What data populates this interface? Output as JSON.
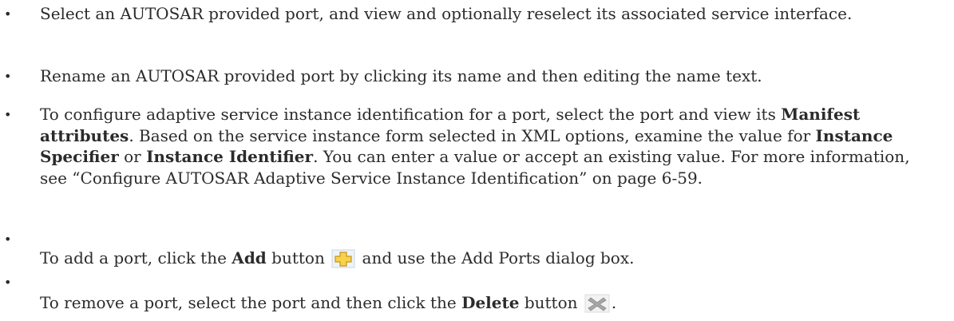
{
  "bullets": [
    {
      "symbol": "•",
      "text": "Select an AUTOSAR provided port, and view and optionally reselect its associated service interface."
    },
    {
      "symbol": "•",
      "text": "Rename an AUTOSAR provided port by clicking its name and then editing the name text."
    },
    {
      "symbol": "•",
      "p1": "To configure adaptive service instance identification for a port, select the port and view its ",
      "b1": "Manifest attributes",
      "p2": ". Based on the service instance form selected in XML options, examine the value for ",
      "b2": "Instance Specifier",
      "p3": " or ",
      "b3": "Instance Identifier",
      "p4": ". You can enter a value or accept an existing value. For more information, see “Configure AUTOSAR Adaptive Service Instance Identification” on page 6-59."
    },
    {
      "symbol": "•",
      "p1": "To add a port, click the ",
      "b1": "Add",
      "p2": " button ",
      "icon": "add-plus-icon",
      "p3": " and use the Add Ports dialog box."
    },
    {
      "symbol": "•",
      "p1": "To remove a port, select the port and then click the ",
      "b1": "Delete",
      "p2": " button ",
      "icon": "delete-x-icon",
      "p3": "."
    }
  ],
  "colors": {
    "text": "#2b2b2b",
    "add_icon_fill": "#f7d24a",
    "add_icon_stroke": "#c9941a",
    "delete_icon": "#9a9a9a"
  }
}
